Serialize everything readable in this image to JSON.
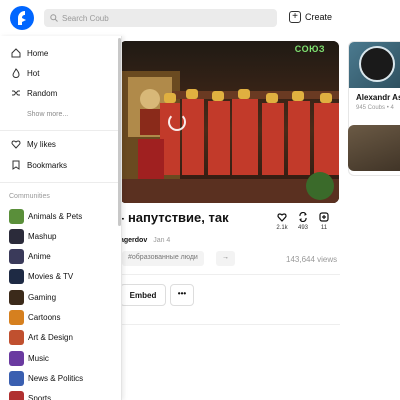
{
  "header": {
    "search_placeholder": "Search Coub",
    "create_label": "Create"
  },
  "sidebar": {
    "nav": [
      {
        "label": "Home",
        "icon": "home-icon"
      },
      {
        "label": "Hot",
        "icon": "flame-icon"
      },
      {
        "label": "Random",
        "icon": "shuffle-icon"
      }
    ],
    "show_more": "Show more...",
    "secondary": [
      {
        "label": "My likes",
        "icon": "heart-icon"
      },
      {
        "label": "Bookmarks",
        "icon": "bookmark-icon"
      }
    ],
    "communities_label": "Communities",
    "communities": [
      {
        "label": "Animals & Pets",
        "color": "#5a8f3a"
      },
      {
        "label": "Mashup",
        "color": "#2b2b3a"
      },
      {
        "label": "Anime",
        "color": "#3a3a5a"
      },
      {
        "label": "Movies & TV",
        "color": "#1e2a44"
      },
      {
        "label": "Gaming",
        "color": "#3b2a1a"
      },
      {
        "label": "Cartoons",
        "color": "#d6801f"
      },
      {
        "label": "Art & Design",
        "color": "#c0502f"
      },
      {
        "label": "Music",
        "color": "#6a3aa0"
      },
      {
        "label": "News & Politics",
        "color": "#3a5fb0"
      },
      {
        "label": "Sports",
        "color": "#b03030"
      }
    ]
  },
  "coub": {
    "title": "- напутствие, так",
    "author": "agerdov",
    "date": "Jan 4",
    "video_badge": "СОЮЗ",
    "likes": "2.1k",
    "recoubs": "493",
    "reposts": "11",
    "tag": "#образованные люди",
    "more_tags": "→",
    "views": "143,644 views",
    "embed_label": "Embed",
    "more_label": "•••"
  },
  "related": {
    "name": "Alexandr Asp",
    "sub": "945 Coubs • 4"
  },
  "colors": {
    "accent": "#0066ff",
    "sidebar_border": "#e4e4e4"
  }
}
